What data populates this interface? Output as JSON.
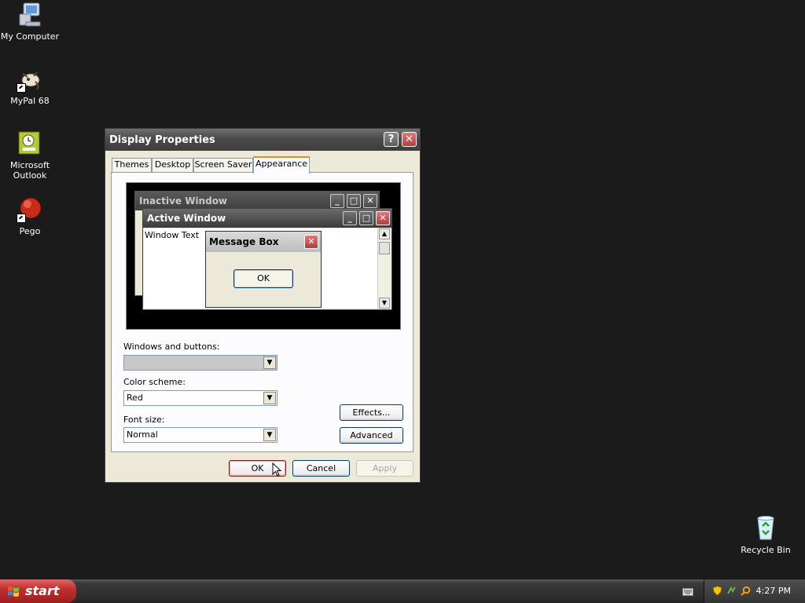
{
  "desktop": {
    "icons": [
      {
        "label": "My Computer",
        "icon": "my-computer-icon"
      },
      {
        "label": "MyPal 68",
        "icon": "mypal-icon"
      },
      {
        "label": "Microsoft\nOutlook",
        "line1": "Microsoft",
        "line2": "Outlook",
        "icon": "outlook-icon"
      },
      {
        "label": "Pego",
        "icon": "pego-icon"
      },
      {
        "label": "Recycle Bin",
        "icon": "recycle-bin-icon"
      }
    ]
  },
  "dialog": {
    "title": "Display Properties",
    "help_glyph": "?",
    "close_glyph": "✕",
    "tabs": [
      "Themes",
      "Desktop",
      "Screen Saver",
      "Appearance"
    ],
    "active_tab": "Appearance",
    "preview": {
      "inactive_title": "Inactive Window",
      "active_title": "Active Window",
      "window_text": "Window Text",
      "message_box_title": "Message Box",
      "message_box_ok": "OK"
    },
    "windows_buttons_label": "Windows and buttons:",
    "windows_buttons_value": "",
    "color_scheme_label": "Color scheme:",
    "color_scheme_value": "Red",
    "font_size_label": "Font size:",
    "font_size_value": "Normal",
    "effects_label": "Effects...",
    "advanced_label": "Advanced",
    "ok_label": "OK",
    "cancel_label": "Cancel",
    "apply_label": "Apply"
  },
  "taskbar": {
    "start_label": "start",
    "clock": "4:27 PM"
  },
  "colors": {
    "desktop_bg": "#1b1b1b",
    "start_red": "#c03030",
    "tab_accent": "#e68b2c"
  }
}
